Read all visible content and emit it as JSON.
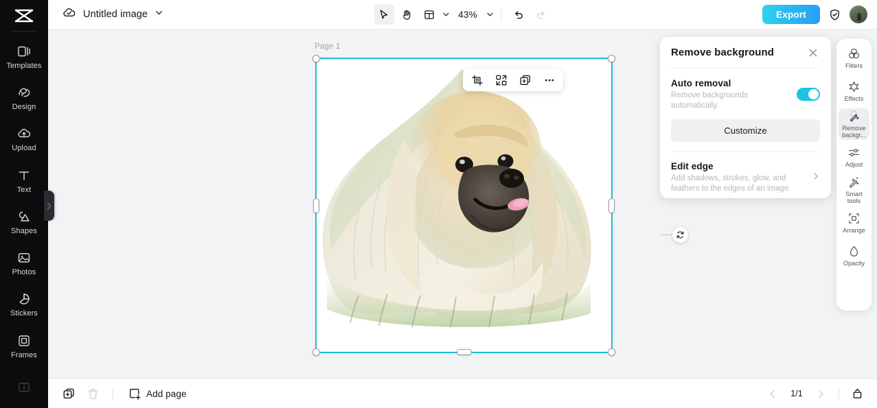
{
  "app": {
    "logo": "capcut-logo",
    "background_accent": "#18c0d6",
    "export_accent": "#2bb6f0"
  },
  "left_rail": {
    "items": [
      {
        "label": "Templates",
        "icon": "templates-icon"
      },
      {
        "label": "Design",
        "icon": "design-icon"
      },
      {
        "label": "Upload",
        "icon": "upload-icon"
      },
      {
        "label": "Text",
        "icon": "text-icon"
      },
      {
        "label": "Shapes",
        "icon": "shapes-icon"
      },
      {
        "label": "Photos",
        "icon": "photos-icon"
      },
      {
        "label": "Stickers",
        "icon": "stickers-icon"
      },
      {
        "label": "Frames",
        "icon": "frames-icon"
      }
    ]
  },
  "topbar": {
    "cloud_icon": "cloud-saved-icon",
    "doc_title": "Untitled image",
    "title_chevron": "chevron-down-icon",
    "tools": [
      {
        "name": "select-tool",
        "icon": "cursor-arrow-icon",
        "active": true
      },
      {
        "name": "hand-tool",
        "icon": "hand-icon",
        "active": false
      },
      {
        "name": "layout-tool",
        "icon": "layout-grid-icon",
        "active": false
      }
    ],
    "zoom_level": "43%",
    "zoom_chevron": "chevron-down-icon",
    "undo_icon": "undo-icon",
    "redo_icon": "redo-icon",
    "export_label": "Export",
    "shield_icon": "shield-check-icon",
    "avatar": "user-avatar"
  },
  "canvas": {
    "page_label": "Page 1",
    "object_toolbar": [
      {
        "name": "crop-button",
        "icon": "crop-icon"
      },
      {
        "name": "replace-button",
        "icon": "swap-shapes-icon"
      },
      {
        "name": "duplicate-button",
        "icon": "duplicate-icon"
      },
      {
        "name": "more-button",
        "icon": "more-horizontal-icon"
      }
    ],
    "rotate_icon": "rotate-icon",
    "image_alt": "pekingese-dog-cutout"
  },
  "remove_background_panel": {
    "title": "Remove background",
    "close_icon": "close-icon",
    "auto_removal": {
      "title": "Auto removal",
      "description": "Remove backgrounds automatically.",
      "toggle_on": true
    },
    "customize_label": "Customize",
    "edit_edge": {
      "title": "Edit edge",
      "description": "Add shadows, strokes, glow, and feathers to the edges of an image.",
      "chevron": "chevron-right-icon"
    }
  },
  "right_rail": {
    "items": [
      {
        "label": "Filters",
        "icon": "filters-icon",
        "active": false
      },
      {
        "label": "Effects",
        "icon": "effects-icon",
        "active": false
      },
      {
        "label": "Remove backgr...",
        "icon": "magic-wand-icon",
        "active": true
      },
      {
        "label": "Adjust",
        "icon": "sliders-icon",
        "active": false
      },
      {
        "label": "Smart tools",
        "icon": "smart-wand-icon",
        "active": false
      },
      {
        "label": "Arrange",
        "icon": "arrange-icon",
        "active": false
      },
      {
        "label": "Opacity",
        "icon": "opacity-drop-icon",
        "active": false
      }
    ]
  },
  "bottombar": {
    "duplicate_page_icon": "duplicate-page-icon",
    "delete_page_icon": "trash-icon",
    "add_page_label": "Add page",
    "add_page_icon": "add-page-icon",
    "prev_icon": "chevron-left-icon",
    "next_icon": "chevron-right-icon",
    "page_indicator": "1/1",
    "pages_panel_icon": "pages-panel-icon"
  }
}
